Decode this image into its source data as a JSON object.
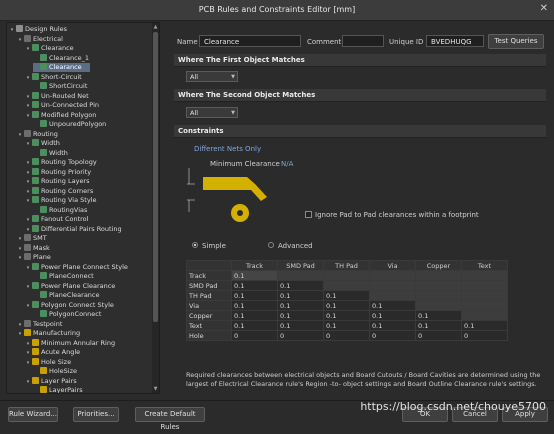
{
  "window": {
    "title": "PCB Rules and Constraints Editor [mm]",
    "close_glyph": "✕"
  },
  "tree": [
    {
      "label": "Design Rules",
      "icon": "folder-icon",
      "level": 0
    },
    {
      "label": "Electrical",
      "icon": "category-icon",
      "level": 1
    },
    {
      "label": "Clearance",
      "icon": "rule-icon",
      "level": 2
    },
    {
      "label": "Clearance_1",
      "icon": "rule-icon",
      "level": 3
    },
    {
      "label": "Clearance",
      "icon": "rule-icon",
      "level": 3,
      "selected": true
    },
    {
      "label": "Short-Circuit",
      "icon": "rule-icon",
      "level": 2
    },
    {
      "label": "ShortCircuit",
      "icon": "rule-icon",
      "level": 3
    },
    {
      "label": "Un-Routed Net",
      "icon": "rule-icon",
      "level": 2
    },
    {
      "label": "Un-Connected Pin",
      "icon": "rule-icon",
      "level": 2
    },
    {
      "label": "Modified Polygon",
      "icon": "rule-icon",
      "level": 2
    },
    {
      "label": "UnpouredPolygon",
      "icon": "rule-icon",
      "level": 3
    },
    {
      "label": "Routing",
      "icon": "category-icon",
      "level": 1
    },
    {
      "label": "Width",
      "icon": "rule-icon",
      "level": 2
    },
    {
      "label": "Width",
      "icon": "rule-icon",
      "level": 3
    },
    {
      "label": "Routing Topology",
      "icon": "rule-icon",
      "level": 2
    },
    {
      "label": "Routing Priority",
      "icon": "rule-icon",
      "level": 2
    },
    {
      "label": "Routing Layers",
      "icon": "rule-icon",
      "level": 2
    },
    {
      "label": "Routing Corners",
      "icon": "rule-icon",
      "level": 2
    },
    {
      "label": "Routing Via Style",
      "icon": "rule-icon",
      "level": 2
    },
    {
      "label": "RoutingVias",
      "icon": "rule-icon",
      "level": 3
    },
    {
      "label": "Fanout Control",
      "icon": "rule-icon",
      "level": 2
    },
    {
      "label": "Differential Pairs Routing",
      "icon": "rule-icon",
      "level": 2
    },
    {
      "label": "SMT",
      "icon": "category-icon",
      "level": 1
    },
    {
      "label": "Mask",
      "icon": "category-icon",
      "level": 1
    },
    {
      "label": "Plane",
      "icon": "category-icon",
      "level": 1
    },
    {
      "label": "Power Plane Connect Style",
      "icon": "rule-icon",
      "level": 2
    },
    {
      "label": "PlaneConnect",
      "icon": "rule-icon",
      "level": 3
    },
    {
      "label": "Power Plane Clearance",
      "icon": "rule-icon",
      "level": 2
    },
    {
      "label": "PlaneClearance",
      "icon": "rule-icon",
      "level": 3
    },
    {
      "label": "Polygon Connect Style",
      "icon": "rule-icon",
      "level": 2
    },
    {
      "label": "PolygonConnect",
      "icon": "rule-icon",
      "level": 3
    },
    {
      "label": "Testpoint",
      "icon": "category-icon",
      "level": 1
    },
    {
      "label": "Manufacturing",
      "icon": "mfg-icon",
      "level": 1
    },
    {
      "label": "Minimum Annular Ring",
      "icon": "mfg-icon",
      "level": 2
    },
    {
      "label": "Acute Angle",
      "icon": "mfg-icon",
      "level": 2
    },
    {
      "label": "Hole Size",
      "icon": "mfg-icon",
      "level": 2
    },
    {
      "label": "HoleSize",
      "icon": "mfg-icon",
      "level": 3
    },
    {
      "label": "Layer Pairs",
      "icon": "mfg-icon",
      "level": 2
    },
    {
      "label": "LayerPairs",
      "icon": "mfg-icon",
      "level": 3
    }
  ],
  "header": {
    "name_label": "Name",
    "name_value": "Clearance",
    "comment_label": "Comment",
    "comment_value": "",
    "uid_label": "Unique ID",
    "uid_value": "BVEDHUQG",
    "test_queries": "Test Queries"
  },
  "first_match": {
    "title": "Where The First Object Matches",
    "value": "All"
  },
  "second_match": {
    "title": "Where The Second Object Matches",
    "value": "All"
  },
  "constraints": {
    "title": "Constraints",
    "net_mode": "Different Nets Only",
    "min_clearance_label": "Minimum Clearance",
    "min_clearance_value": "N/A",
    "ignore_pad_label": "Ignore Pad to Pad clearances within a footprint",
    "simple_label": "Simple",
    "advanced_label": "Advanced",
    "columns": [
      "",
      "Track",
      "SMD Pad",
      "TH Pad",
      "Via",
      "Copper",
      "Text"
    ],
    "rows": [
      {
        "name": "Track",
        "cells": [
          "0.1",
          "",
          "",
          "",
          "",
          ""
        ]
      },
      {
        "name": "SMD Pad",
        "cells": [
          "0.1",
          "0.1",
          "",
          "",
          "",
          ""
        ]
      },
      {
        "name": "TH Pad",
        "cells": [
          "0.1",
          "0.1",
          "0.1",
          "",
          "",
          ""
        ]
      },
      {
        "name": "Via",
        "cells": [
          "0.1",
          "0.1",
          "0.1",
          "0.1",
          "",
          ""
        ]
      },
      {
        "name": "Copper",
        "cells": [
          "0.1",
          "0.1",
          "0.1",
          "0.1",
          "0.1",
          ""
        ]
      },
      {
        "name": "Text",
        "cells": [
          "0.1",
          "0.1",
          "0.1",
          "0.1",
          "0.1",
          "0.1"
        ]
      },
      {
        "name": "Hole",
        "cells": [
          "0",
          "0",
          "0",
          "0",
          "0",
          "0"
        ]
      }
    ],
    "footnote": "Required clearances between electrical objects and Board Cutouts / Board Cavities are determined using the largest of Electrical Clearance rule's Region -to- object settings and Board Outline Clearance rule's settings."
  },
  "footer": {
    "rule_wizard": "Rule Wizard...",
    "priorities": "Priorities...",
    "create_default": "Create Default Rules",
    "ok": "OK",
    "cancel": "Cancel",
    "apply": "Apply"
  },
  "watermark": "https://blog.csdn.net/chouye5700",
  "colors": {
    "accent": "#5a6c86",
    "shape": "#d4b000",
    "link": "#7fa6e0"
  }
}
